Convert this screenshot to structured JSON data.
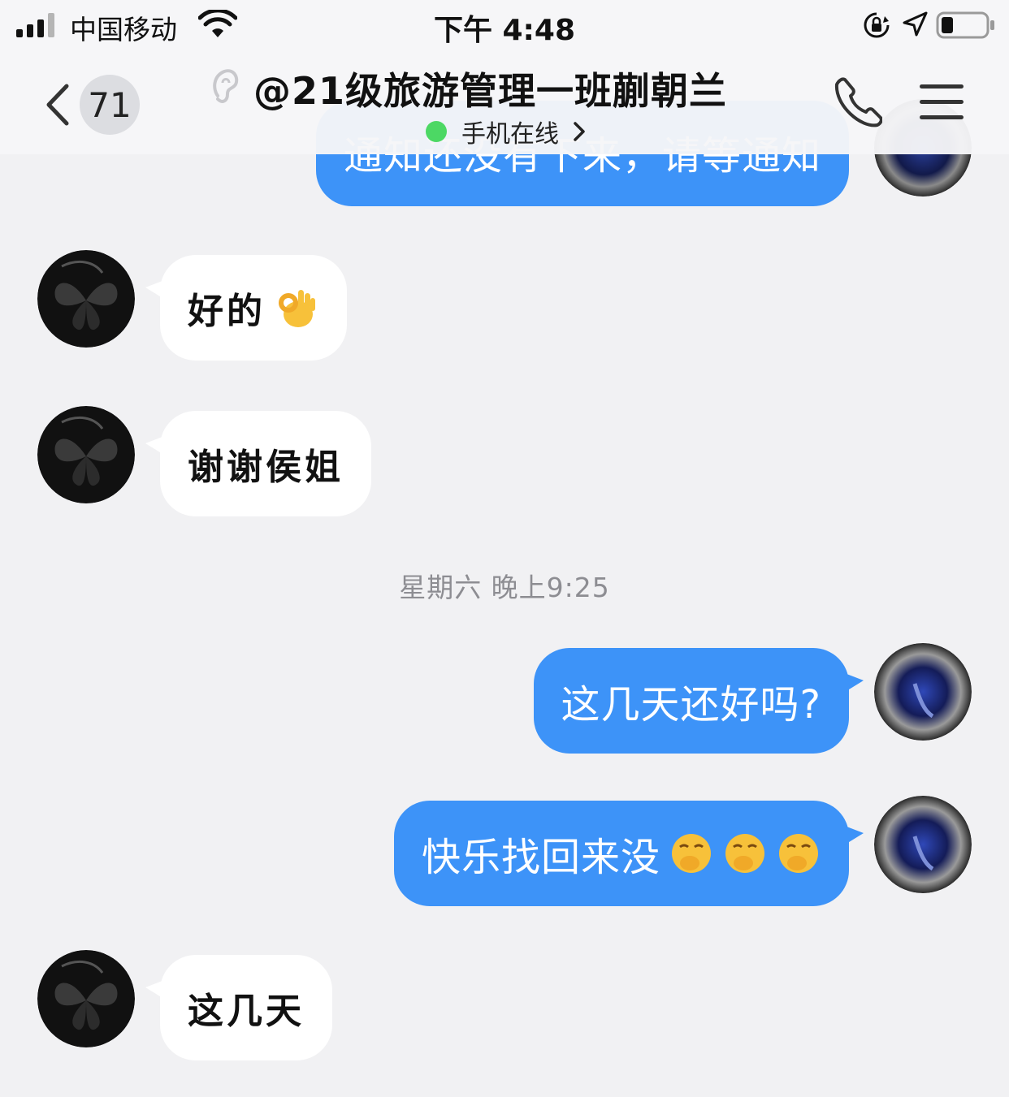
{
  "status_bar": {
    "carrier": "中国移动",
    "time": "下午 4:48"
  },
  "header": {
    "unread_count": "71",
    "title": "@21级旅游管理一班蒯朝兰",
    "subtitle": "手机在线"
  },
  "messages": [
    {
      "side": "me",
      "text": "通知还没有下来，请等通知",
      "partial": true
    },
    {
      "side": "peer",
      "text": "好的",
      "emoji": "ok-hand-emoji"
    },
    {
      "side": "peer",
      "text": "谢谢侯姐"
    },
    {
      "side": "timestamp",
      "text": "星期六 晚上9:25"
    },
    {
      "side": "me",
      "text": "这几天还好吗?"
    },
    {
      "side": "me",
      "text": "快乐找回来没",
      "emoji": "yawning-face-emoji x3"
    },
    {
      "side": "peer",
      "text": "这几天"
    }
  ],
  "colors": {
    "background": "#f1f1f3",
    "outgoing_bubble": "#3d93f8",
    "incoming_bubble": "#ffffff",
    "online_dot": "#4cd864",
    "timestamp": "#8d8d92"
  }
}
